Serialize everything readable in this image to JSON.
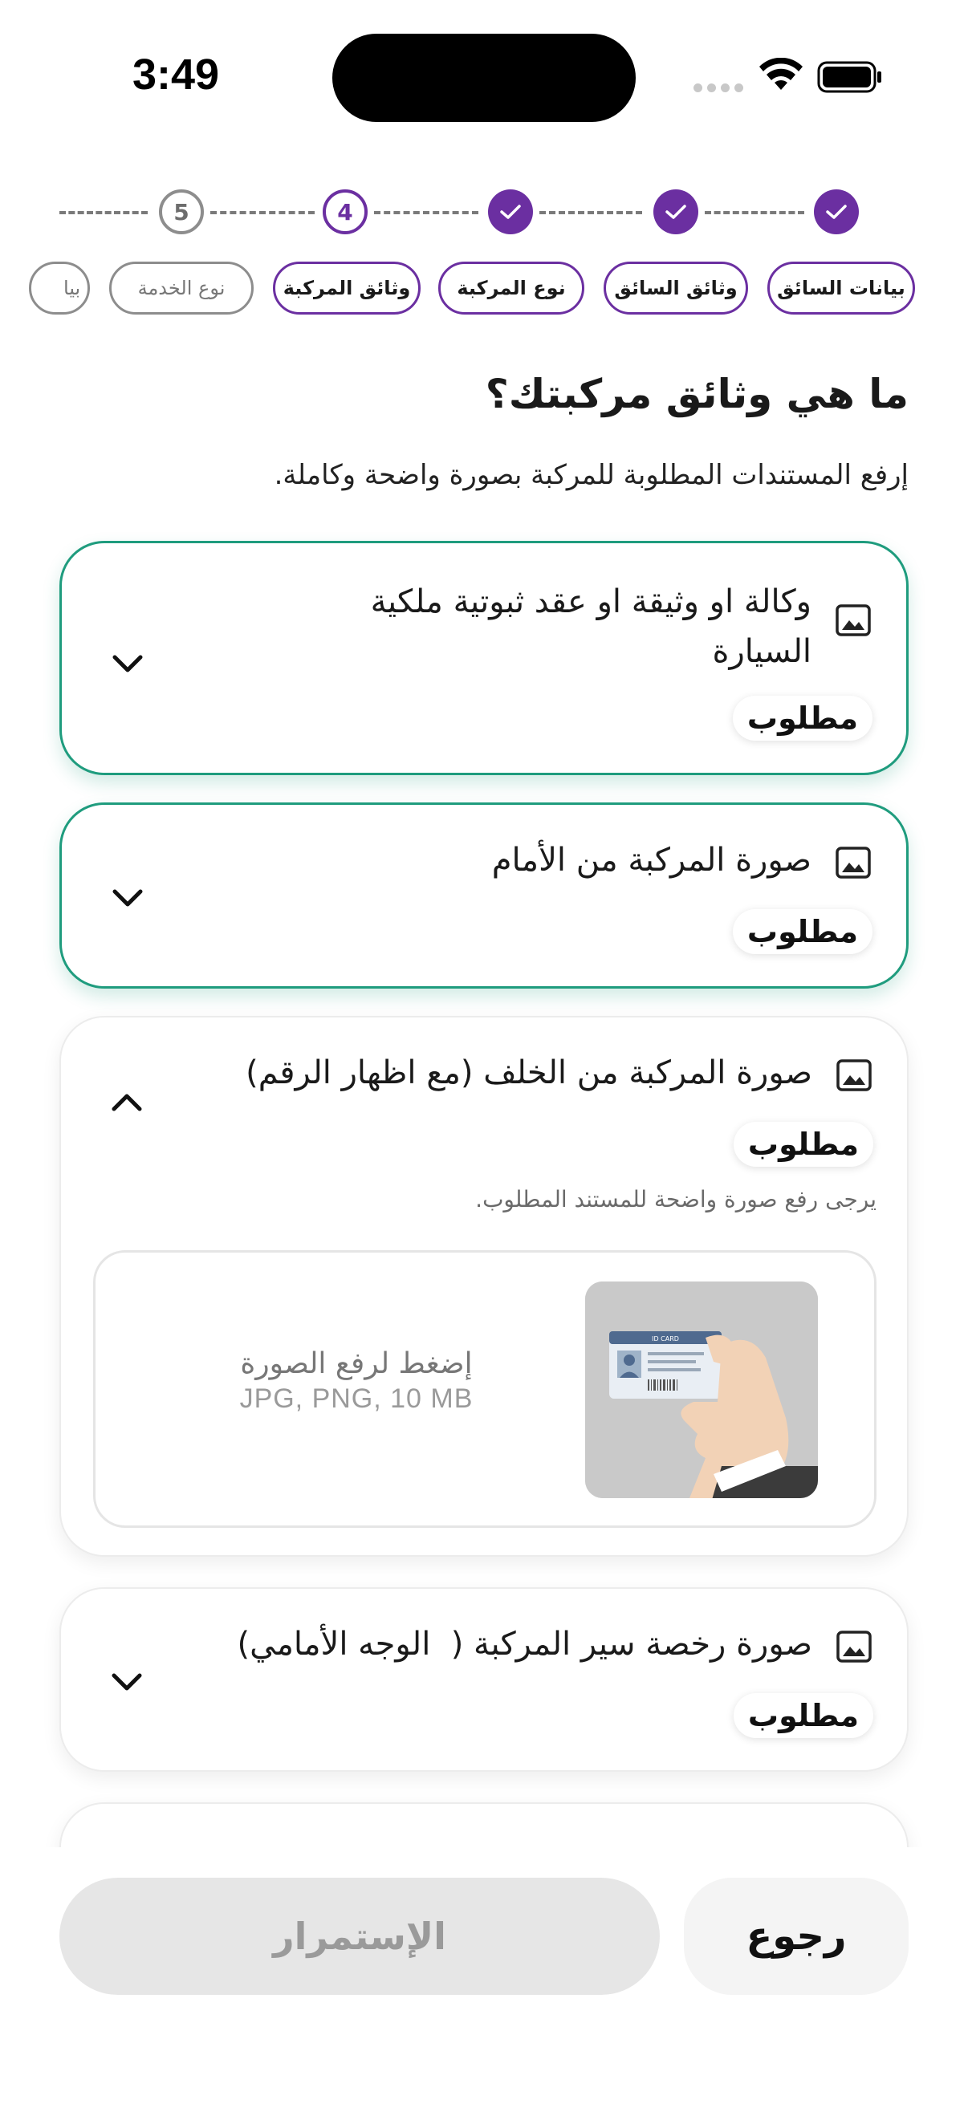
{
  "status_bar": {
    "time": "3:49"
  },
  "stepper": {
    "steps": [
      {
        "label": "بيانات السائق",
        "state": "done"
      },
      {
        "label": "وثائق السائق",
        "state": "done"
      },
      {
        "label": "نوع المركبة",
        "state": "done"
      },
      {
        "label": "وثائق المركبة",
        "state": "current",
        "number": "4"
      },
      {
        "label": "نوع الخدمة",
        "state": "todo",
        "number": "5"
      },
      {
        "label": "بيا",
        "state": "todo"
      }
    ]
  },
  "page": {
    "title": "ما هي وثائق مركبتك؟",
    "subtitle": "إرفع المستندات المطلوبة للمركبة بصورة واضحة وكاملة."
  },
  "documents": [
    {
      "title_line1": "وكالة او وثيقة او عقد ثبوتية ملكية",
      "title_line2": "السيارة",
      "badge": "مطلوب",
      "status": "uploaded"
    },
    {
      "title": "صورة المركبة من الأمام",
      "badge": "مطلوب",
      "status": "uploaded"
    },
    {
      "title": "صورة المركبة من الخلف (مع اظهار الرقم)",
      "badge": "مطلوب",
      "status": "expanded",
      "hint": "يرجى رفع صورة واضحة للمستند المطلوب.",
      "upload": {
        "cta": "إضغط لرفع الصورة",
        "formats": "JPG, PNG, 10 MB",
        "thumb_text": "ID CARD"
      }
    },
    {
      "title": "صورة رخصة سير المركبة (  الوجه الأمامي)",
      "badge": "مطلوب",
      "status": "pending"
    }
  ],
  "buttons": {
    "back": "رجوع",
    "continue": "الإستمرار"
  },
  "colors": {
    "brand": "#6b2fa1",
    "success": "#1f9c7e",
    "disabled": "#e6e6e6"
  },
  "icons": [
    "wifi-icon",
    "battery-icon",
    "check-icon",
    "image-icon",
    "chevron-down-icon",
    "chevron-up-icon"
  ]
}
